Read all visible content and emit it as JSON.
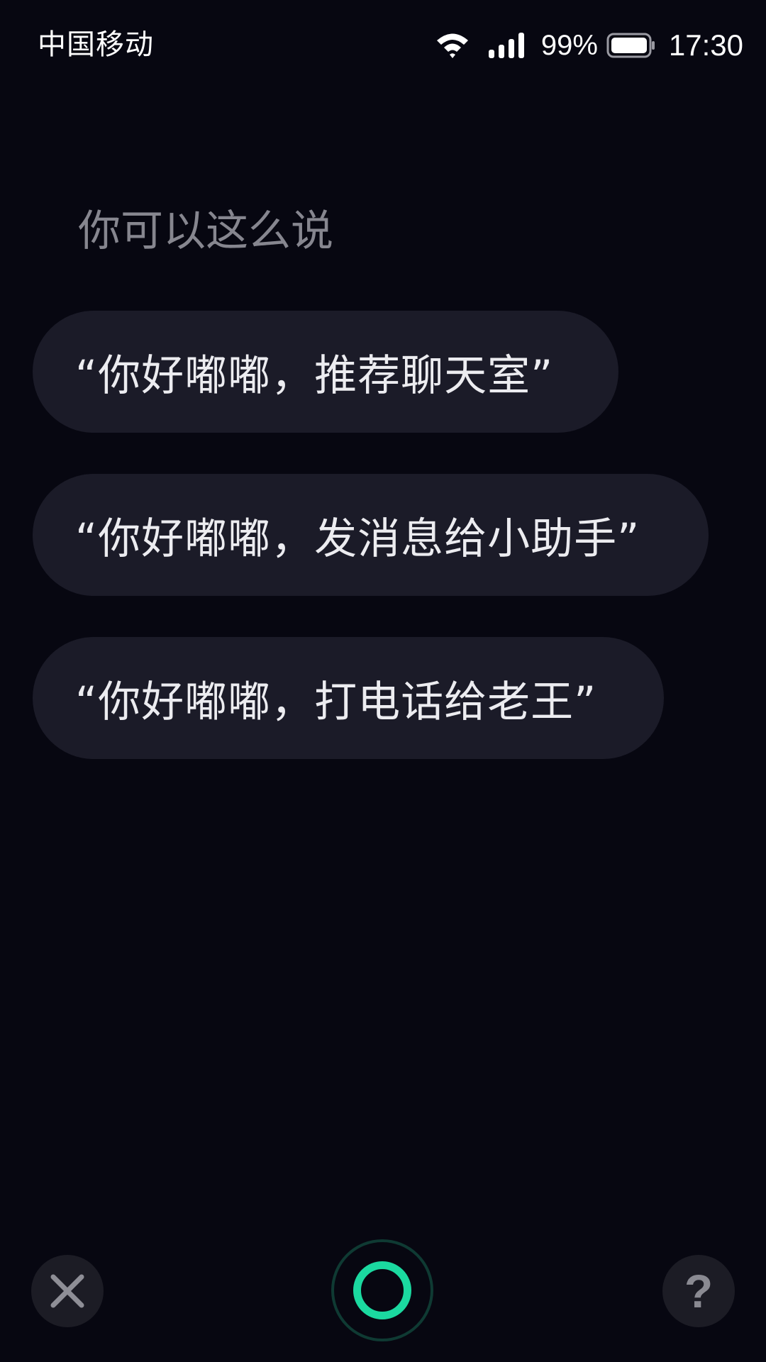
{
  "status_bar": {
    "carrier": "中国移动",
    "battery_percent": "99%",
    "time": "17:30",
    "icons": [
      "wifi-icon",
      "signal-icon",
      "battery-icon"
    ]
  },
  "hint": {
    "heading": "你可以这么说"
  },
  "suggestions": [
    {
      "text": "“你好嘟嘟，推荐聊天室”"
    },
    {
      "text": "“你好嘟嘟，发消息给小助手”"
    },
    {
      "text": "“你好嘟嘟，打电话给老王”"
    }
  ],
  "controls": {
    "close_icon": "close-icon",
    "mic_icon": "voice-ring-icon",
    "help_label": "?"
  },
  "colors": {
    "background": "#070711",
    "pill": "#1b1b28",
    "accent": "#1bd9a0",
    "hint_text": "#86868f"
  }
}
